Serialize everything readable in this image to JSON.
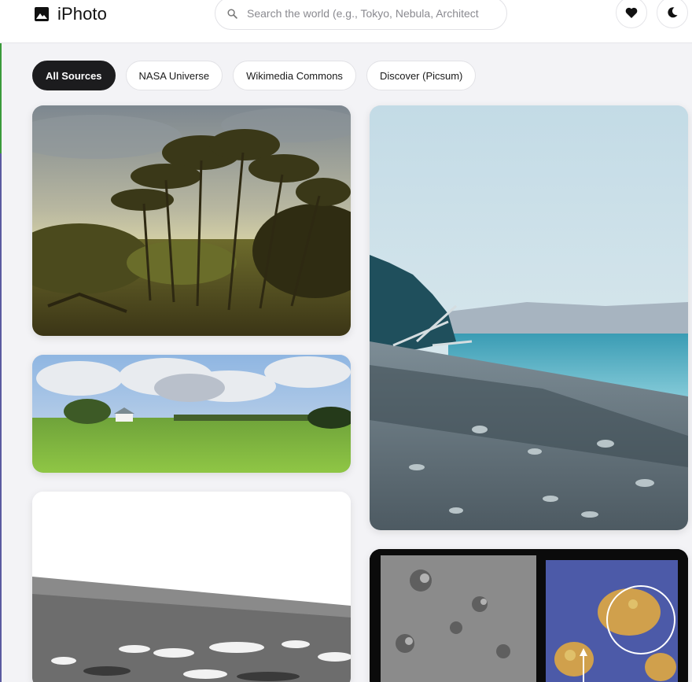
{
  "app": {
    "title": "iPhoto",
    "brand_icon": "image-icon"
  },
  "search": {
    "placeholder": "Search the world (e.g., Tokyo, Nebula, Architect",
    "value": ""
  },
  "header_actions": [
    {
      "icon": "heart-icon",
      "label": "Favorites"
    },
    {
      "icon": "moon-icon",
      "label": "Theme"
    }
  ],
  "filters": {
    "active": "All Sources",
    "items": [
      "All Sources",
      "NASA Universe",
      "Wikimedia Commons",
      "Discover (Picsum)"
    ]
  },
  "colors": {
    "accent": "#1c1c1e",
    "background": "#f3f3f6"
  },
  "gallery": [
    {
      "subject": "forest landscape painting"
    },
    {
      "subject": "coastal pebble beach"
    },
    {
      "subject": "green meadow with farmhouse"
    },
    {
      "subject": "mars surface black and white"
    },
    {
      "subject": "lunar crater comparison"
    }
  ]
}
